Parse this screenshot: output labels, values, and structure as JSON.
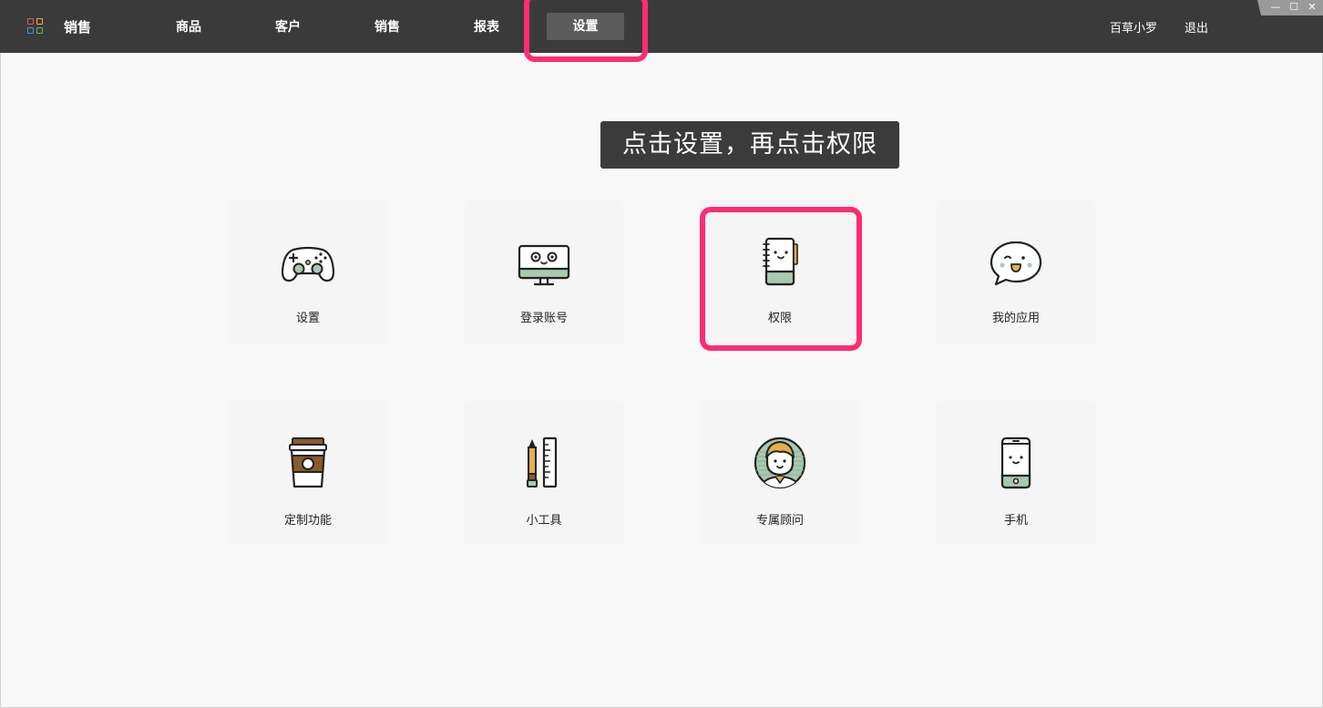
{
  "app": {
    "brand": "销售"
  },
  "nav": [
    "商品",
    "客户",
    "销售",
    "报表",
    "设置"
  ],
  "header": {
    "user": "百草小罗",
    "logout": "退出"
  },
  "window_controls": {
    "minimize": "—",
    "maximize": "☐",
    "close": "✕"
  },
  "tooltip": "点击设置，再点击权限",
  "cards": [
    {
      "label": "设置",
      "icon": "gamepad-icon"
    },
    {
      "label": "登录账号",
      "icon": "monitor-icon"
    },
    {
      "label": "权限",
      "icon": "notebook-icon"
    },
    {
      "label": "我的应用",
      "icon": "chat-bubble-icon"
    },
    {
      "label": "定制功能",
      "icon": "coffee-cup-icon"
    },
    {
      "label": "小工具",
      "icon": "pencil-ruler-icon"
    },
    {
      "label": "专属顾问",
      "icon": "advisor-avatar-icon"
    },
    {
      "label": "手机",
      "icon": "mobile-phone-icon"
    }
  ],
  "colors": {
    "topbar": "#3a3a3a",
    "active_tab": "#5c5c5c",
    "highlight": "#ff2d6f",
    "tooltip": "#3b3b3b",
    "icon_green": "#a9c9b1",
    "icon_brown": "#8b5a2b",
    "icon_gold": "#e2b04a"
  }
}
